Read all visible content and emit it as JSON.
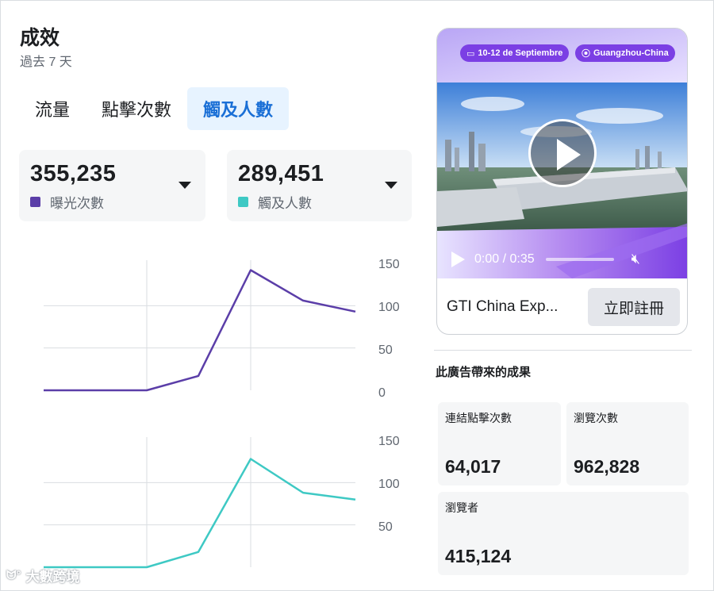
{
  "header": {
    "title": "成效",
    "subtitle": "過去 7 天"
  },
  "tabs": [
    {
      "label": "流量",
      "active": false
    },
    {
      "label": "點擊次數",
      "active": false
    },
    {
      "label": "觸及人數",
      "active": true
    }
  ],
  "stats": [
    {
      "value": "355,235",
      "label": "曝光次數",
      "color": "#5b3ea8"
    },
    {
      "value": "289,451",
      "label": "觸及人數",
      "color": "#3ec9c4"
    }
  ],
  "chart_data": [
    {
      "type": "line",
      "series": [
        {
          "values": [
            0,
            0,
            17,
            142,
            106,
            93
          ]
        }
      ],
      "x": [
        0,
        1,
        2,
        3,
        4,
        5
      ],
      "ylim": [
        0,
        150
      ],
      "yticks": [
        "150",
        "100",
        "50",
        "0"
      ],
      "grid": true,
      "color": "#5b3ea8"
    },
    {
      "type": "line",
      "series": [
        {
          "values": [
            0,
            0,
            18,
            128,
            88,
            80
          ]
        }
      ],
      "x": [
        0,
        1,
        2,
        3,
        4,
        5
      ],
      "ylim": [
        0,
        150
      ],
      "yticks": [
        "150",
        "100",
        "50"
      ],
      "grid": true,
      "color": "#3ec9c4"
    }
  ],
  "ad": {
    "date_pill": "10-12 de Septiembre",
    "location_pill": "Guangzhou-China",
    "video_time": "0:00 / 0:35",
    "name": "GTI China Exp...",
    "cta_label": "立即註冊"
  },
  "results": {
    "title": "此廣告帶來的成果",
    "metrics": [
      {
        "label": "連結點擊次數",
        "value": "64,017"
      },
      {
        "label": "瀏覽次數",
        "value": "962,828"
      },
      {
        "label": "瀏覽者",
        "value": "415,124"
      }
    ]
  },
  "watermark": {
    "text": "大數跨境"
  }
}
